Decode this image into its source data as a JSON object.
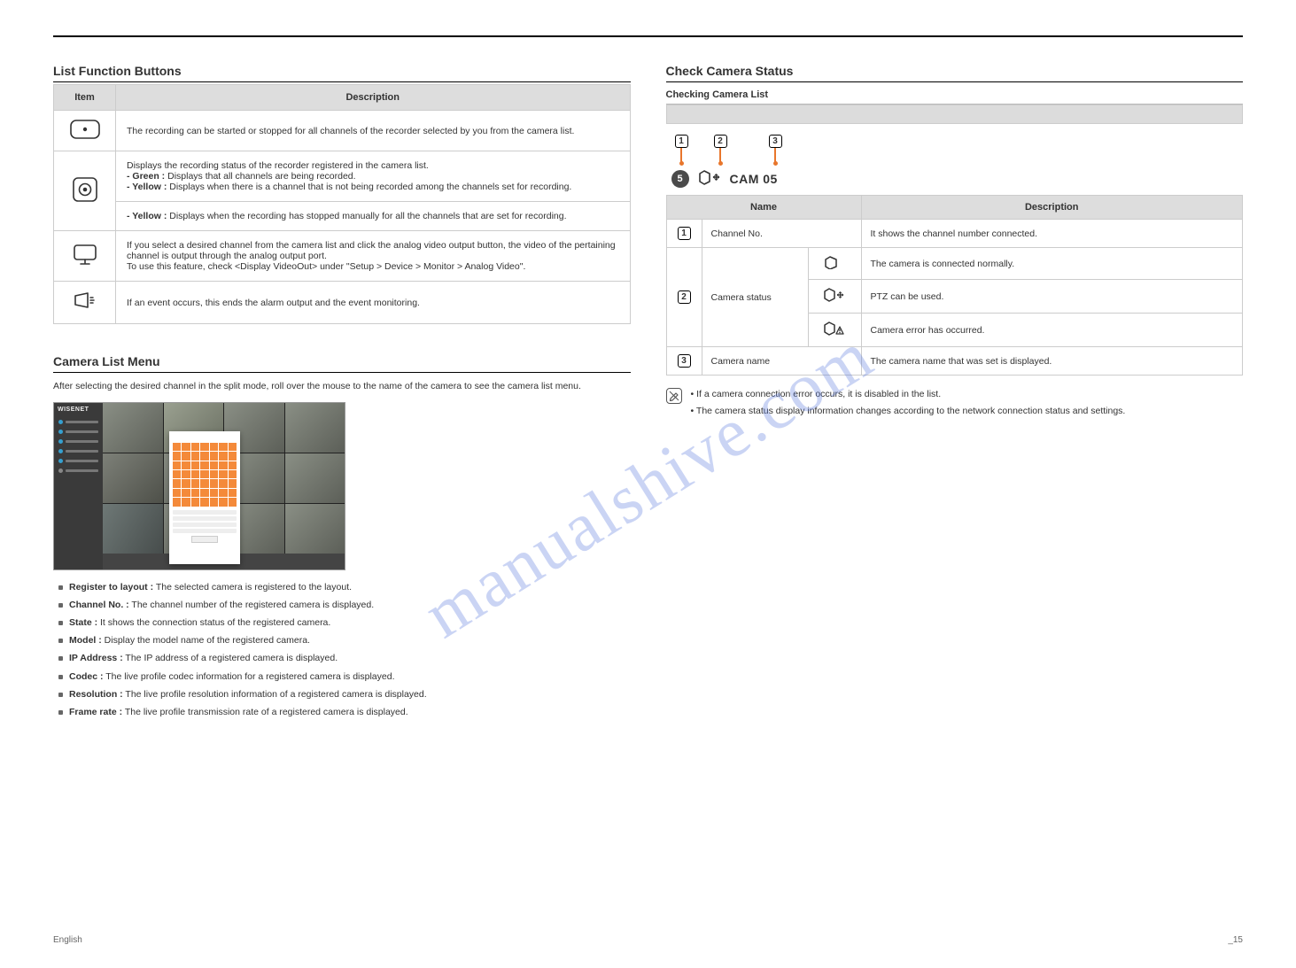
{
  "page": {
    "footer_left": "English",
    "footer_right": "_15",
    "watermark": "manualshive.com"
  },
  "left": {
    "section_title": "List Function Buttons",
    "table": {
      "head_item": "Item",
      "head_desc": "Description",
      "rows": [
        {
          "icon": "rec-button-icon",
          "desc_line1": "The recording can be started or stopped for all channels of the recorder selected by you from the camera list.",
          "desc_line2": ""
        },
        {
          "icon": "rec-indicator-icon",
          "desc_line1": "Displays the recording status of the recorder registered in the camera list.",
          "desc_sub_a_label": "- Green :",
          "desc_sub_a_text": " Displays that all channels are being recorded.",
          "desc_sub_b_label": "- Yellow :",
          "desc_sub_b_text": " Displays when there is a channel that is not being recorded among the channels set for recording.",
          "desc_sub_c_label": "- Yellow :",
          "desc_sub_c_text": " Displays when the recording has stopped manually for all the channels that are set for recording."
        },
        {
          "icon": "monitor-icon",
          "desc_line1": "If you select a desired channel from the camera list and click the analog video output button, the video of the pertaining channel is output through the analog output port.",
          "desc_line2": "To use this feature, check <Display VideoOut> under \"Setup > Device > Monitor > Analog Video\"."
        },
        {
          "icon": "alarm-stop-icon",
          "desc_line1": "If an event occurs, this ends the alarm output and the event monitoring."
        }
      ]
    },
    "section2_title": "Camera List Menu",
    "section2_desc": "After selecting the desired channel in the split mode, roll over the mouse to the name of the camera to see the camera list menu.",
    "thumb_brand": "WISENET",
    "bullets": [
      {
        "label": "Register to layout :",
        "text": " The selected camera is registered to the layout."
      },
      {
        "label": "Channel No. :",
        "text": " The channel number of the registered camera is displayed."
      },
      {
        "label": "State :",
        "text": " It shows the connection status of the registered camera."
      },
      {
        "label": "Model :",
        "text": " Display the model name of the registered camera."
      },
      {
        "label": "IP Address :",
        "text": " The IP address of a registered camera is displayed."
      },
      {
        "label": "Codec :",
        "text": " The live profile codec information for a registered camera is displayed."
      },
      {
        "label": "Resolution :",
        "text": " The live profile resolution information of a registered camera is displayed."
      },
      {
        "label": "Frame rate :",
        "text": " The live profile transmission rate of a registered camera is displayed."
      }
    ]
  },
  "right": {
    "section_title": "Check Camera Status",
    "sub_title": "Checking Camera List",
    "callout": {
      "badge": "5",
      "cam_label": "CAM 05"
    },
    "table": {
      "head_name": "Name",
      "head_desc": "Description",
      "rows": [
        {
          "num": "1",
          "name": "Channel No.",
          "desc": "It shows the channel number connected."
        },
        {
          "num": "2",
          "name_span": "Camera status",
          "icon": "cam-normal-icon",
          "desc": "The camera is connected normally."
        },
        {
          "num": "2b",
          "icon": "cam-ptz-icon",
          "desc": "PTZ can be used."
        },
        {
          "num": "2c",
          "icon": "cam-error-icon",
          "desc": "Camera error has occurred."
        },
        {
          "num": "3",
          "name": "Camera name",
          "desc": "The camera name that was set is displayed."
        }
      ]
    },
    "notes": [
      "If a camera connection error occurs, it is disabled in the list.",
      "The camera status display information changes according to the network connection status and settings."
    ]
  }
}
